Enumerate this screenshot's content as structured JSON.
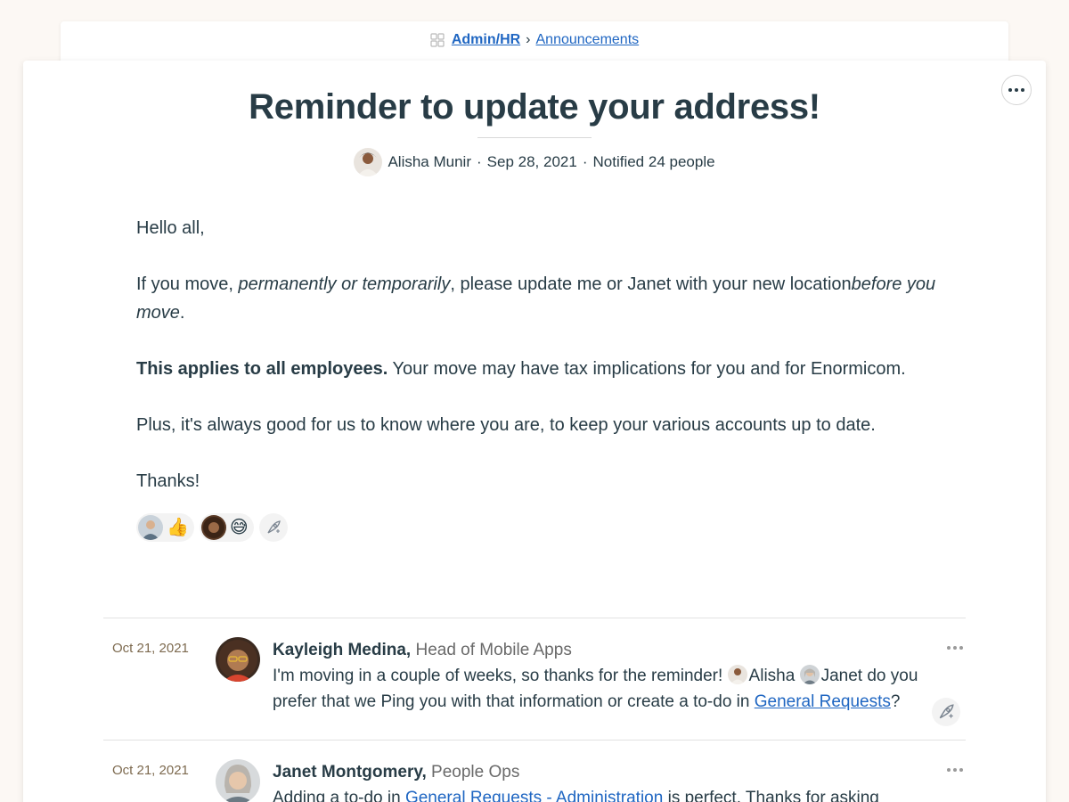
{
  "breadcrumb": {
    "project": "Admin/HR",
    "separator": "›",
    "section": "Announcements"
  },
  "message": {
    "title": "Reminder to update your address!",
    "author": "Alisha Munir",
    "dot1": "·",
    "date": "Sep 28, 2021",
    "dot2": "·",
    "notified": "Notified 24 people",
    "body": {
      "greeting": "Hello all,",
      "p1_a": "If you move, ",
      "p1_b": "permanently or temporarily",
      "p1_c": ", please update me or Janet with your new location",
      "p1_d": "before you move",
      "p1_e": ".",
      "p2_bold": "This applies to all employees.",
      "p2_rest": " Your move may have tax implications for you and for Enormicom.",
      "p3": "Plus, it's always good for us to know where you are, to keep your various accounts up to date.",
      "closing": "Thanks!"
    },
    "reactions": [
      {
        "emoji": "👍"
      },
      {
        "emoji": "😅"
      }
    ]
  },
  "comments": [
    {
      "date": "Oct 21, 2021",
      "author": "Kayleigh Medina,",
      "role": " Head of Mobile Apps",
      "text_a": "I'm moving in a couple of weeks, so thanks for the reminder! ",
      "mention1": "Alisha",
      "text_b": " ",
      "mention2": "Janet",
      "text_c": " do you prefer that we Ping you with that information or create a to-do in ",
      "link": "General Requests",
      "text_d": "?"
    },
    {
      "date": "Oct 21, 2021",
      "author": "Janet Montgomery,",
      "role": " People Ops",
      "text_a": "Adding a to-do in ",
      "link": "General Requests - Administration",
      "text_b": " is perfect. Thanks for asking"
    }
  ],
  "colors": {
    "background": "#fcf8f4",
    "text": "#283c46",
    "link": "#1f66c2",
    "date": "#7d6a4f"
  }
}
